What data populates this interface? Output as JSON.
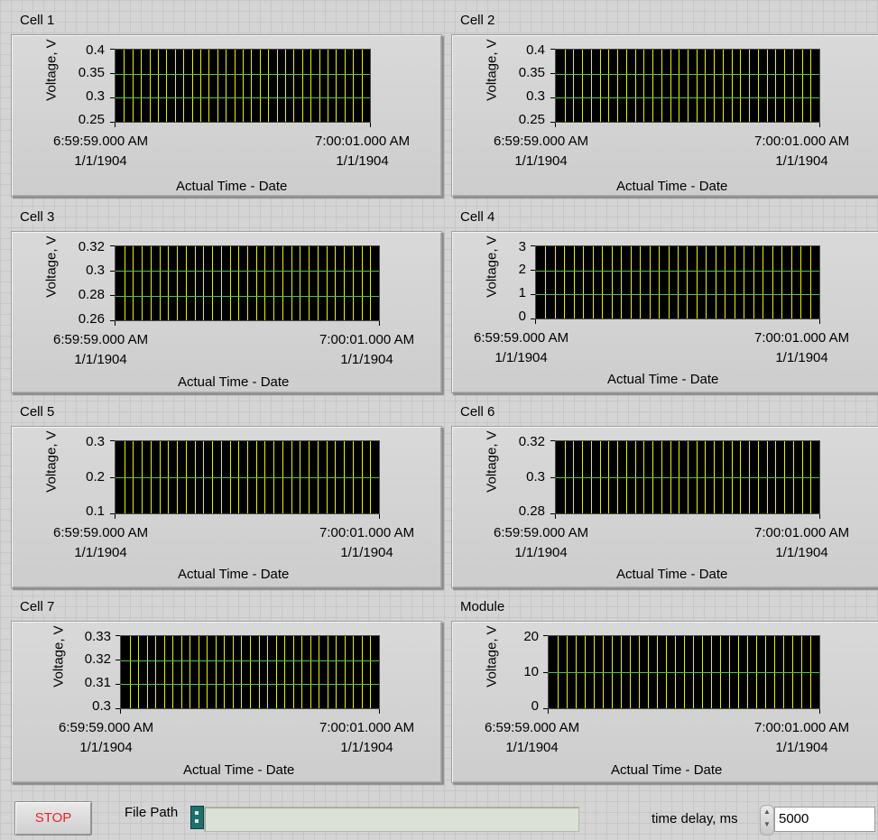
{
  "charts": [
    {
      "label": "Cell 1",
      "ylabel": "Voltage, V",
      "yticks": [
        "0.4",
        "0.35",
        "0.3",
        "0.25"
      ],
      "x_start": "6:59:59.000 AM",
      "x_start_date": "1/1/1904",
      "x_end": "7:00:01.000 AM",
      "x_end_date": "1/1/1904",
      "xlabel": "Actual Time - Date"
    },
    {
      "label": "Cell 2",
      "ylabel": "Voltage, V",
      "yticks": [
        "0.4",
        "0.35",
        "0.3",
        "0.25"
      ],
      "x_start": "6:59:59.000 AM",
      "x_start_date": "1/1/1904",
      "x_end": "7:00:01.000 AM",
      "x_end_date": "1/1/1904",
      "xlabel": "Actual Time - Date"
    },
    {
      "label": "Cell 3",
      "ylabel": "Voltage, V",
      "yticks": [
        "0.32",
        "0.3",
        "0.28",
        "0.26"
      ],
      "x_start": "6:59:59.000 AM",
      "x_start_date": "1/1/1904",
      "x_end": "7:00:01.000 AM",
      "x_end_date": "1/1/1904",
      "xlabel": "Actual Time - Date"
    },
    {
      "label": "Cell 4",
      "ylabel": "Voltage, V",
      "yticks": [
        "3",
        "2",
        "1",
        "0"
      ],
      "x_start": "6:59:59.000 AM",
      "x_start_date": "1/1/1904",
      "x_end": "7:00:01.000 AM",
      "x_end_date": "1/1/1904",
      "xlabel": "Actual Time - Date"
    },
    {
      "label": "Cell 5",
      "ylabel": "Voltage, V",
      "yticks": [
        "0.3",
        "0.2",
        "0.1"
      ],
      "x_start": "6:59:59.000 AM",
      "x_start_date": "1/1/1904",
      "x_end": "7:00:01.000 AM",
      "x_end_date": "1/1/1904",
      "xlabel": "Actual Time - Date"
    },
    {
      "label": "Cell 6",
      "ylabel": "Voltage, V",
      "yticks": [
        "0.32",
        "0.3",
        "0.28"
      ],
      "x_start": "6:59:59.000 AM",
      "x_start_date": "1/1/1904",
      "x_end": "7:00:01.000 AM",
      "x_end_date": "1/1/1904",
      "xlabel": "Actual Time - Date"
    },
    {
      "label": "Cell 7",
      "ylabel": "Voltage, V",
      "yticks": [
        "0.33",
        "0.32",
        "0.31",
        "0.3"
      ],
      "x_start": "6:59:59.000 AM",
      "x_start_date": "1/1/1904",
      "x_end": "7:00:01.000 AM",
      "x_end_date": "1/1/1904",
      "xlabel": "Actual Time - Date"
    },
    {
      "label": "Module",
      "ylabel": "Voltage, V",
      "yticks": [
        "20",
        "10",
        "0"
      ],
      "x_start": "6:59:59.000 AM",
      "x_start_date": "1/1/1904",
      "x_end": "7:00:01.000 AM",
      "x_end_date": "1/1/1904",
      "xlabel": "Actual Time - Date"
    }
  ],
  "controls": {
    "stop_label": "STOP",
    "file_path_label": "File Path",
    "file_path_value": "",
    "time_delay_label": "time delay, ms",
    "time_delay_value": "5000"
  },
  "colors": {
    "plot_background": "#000000",
    "grid_vertical": "#e8f000",
    "grid_horizontal": "#53c24d",
    "stop_text": "#e4262a"
  }
}
